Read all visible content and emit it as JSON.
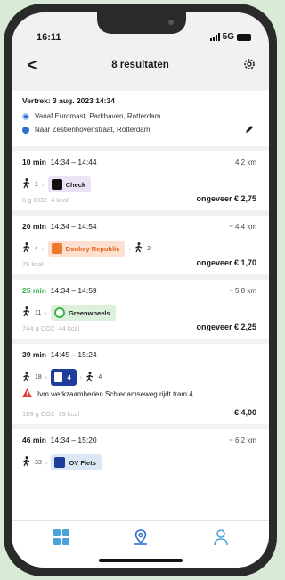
{
  "status": {
    "time": "16:11",
    "network": "5G"
  },
  "header": {
    "back_label": "<",
    "title": "8 resultaten"
  },
  "trip": {
    "departure": "Vertrek: 3 aug. 2023 14:34",
    "from": "Vanaf Euromast, Parkhaven, Rotterdam",
    "to": "Naar Zestienhovenstraat, Rotterdam"
  },
  "results": [
    {
      "duration": "10 min",
      "times": "14:34 – 14:44",
      "distance": "4.2 km",
      "walk_before": "1",
      "provider": "Check",
      "walk_after": "",
      "co2": "0 g CO2",
      "kcal": "4 kcal",
      "price": "ongeveer € 2,75"
    },
    {
      "duration": "20 min",
      "times": "14:34 – 14:54",
      "distance": "~ 4.4 km",
      "walk_before": "4",
      "provider": "Donkey Republic",
      "walk_after": "2",
      "co2": "",
      "kcal": "75 kcal",
      "price": "ongeveer € 1,70"
    },
    {
      "duration": "25 min",
      "times": "14:34 – 14:59",
      "distance": "~ 5.8 km",
      "walk_before": "11",
      "provider": "Greenwheels",
      "walk_after": "",
      "co2": "744 g CO2",
      "kcal": "44 kcal",
      "price": "ongeveer € 2,25"
    },
    {
      "duration": "39 min",
      "times": "14:45 – 15:24",
      "distance": "",
      "walk_before": "18",
      "provider": "4",
      "walk_after": "4",
      "warning": "Ivm werkzaamheden Schiedamseweg rijdt tram 4 ...",
      "co2": "189 g CO2",
      "kcal": "19 kcal",
      "price": "€ 4,00"
    },
    {
      "duration": "46 min",
      "times": "14:34 – 15:20",
      "distance": "~ 6.2 km",
      "walk_before": "33",
      "provider": "OV Fiets",
      "walk_after": ""
    }
  ],
  "colors": {
    "accent_green": "#3bb14a",
    "accent_blue": "#2f6fd1",
    "warning_red": "#e23b3b"
  },
  "tabs": [
    {
      "icon": "grid-icon"
    },
    {
      "icon": "map-pin-icon"
    },
    {
      "icon": "profile-icon"
    }
  ]
}
